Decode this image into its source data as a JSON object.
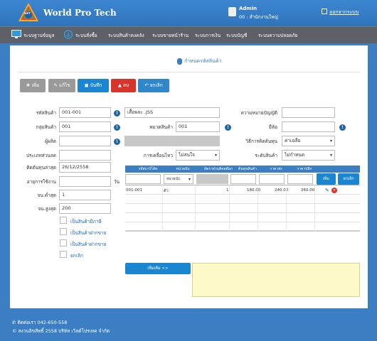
{
  "header": {
    "app_title": "World Pro Tech",
    "logo_text": "WPT",
    "user_name": "Admin",
    "user_branch": "00 : สำนักงานใหญ่",
    "logout_label": "ออกจากระบบ"
  },
  "nav": {
    "items": [
      {
        "label": "ระบบฐานข้อมูล"
      },
      {
        "label": "ระบบสั่งซื้อ"
      },
      {
        "label": "ระบบสินค้าคงคลัง"
      },
      {
        "label": "ระบบขายหน้าร้าน"
      },
      {
        "label": "ระบบการเงิน"
      },
      {
        "label": "ระบบบัญชี"
      },
      {
        "label": "ระบบความปลอดภัย"
      }
    ]
  },
  "page": {
    "title": "กำหนดรหัสสินค้า"
  },
  "toolbar": {
    "add_label": "เพิ่ม",
    "edit_label": "แก้ไข",
    "save_label": "บันทึก",
    "delete_label": "ลบ",
    "cancel_label": "ยกเลิก"
  },
  "form": {
    "product_code_label": "รหัสสินค้า",
    "product_code_value": "001-001",
    "product_name_value": "เสื้อพละ .JSS",
    "meaning_label": "ความหมายบัญญัติ",
    "group_label": "กลุ่มสินค้า",
    "group_value": "001",
    "category_label": "หมวดสินค้า",
    "category_value": "001",
    "brand_label": "ยี่ห้อ",
    "manufacturer_label": "ผู้ผลิต",
    "cost_method_label": "วิธีการคิดต้นทุน",
    "cost_method_value": "ค่าเฉลี่ย",
    "discount_label": "ประเภทส่วนลด",
    "movement_label": "การเคลื่อนไหว",
    "movement_value": "ไม่สนใจ",
    "product_level_label": "ระดับสินค้า",
    "product_level_value": "ไม่กำหนด",
    "cost_date_label": "คิดต้นทุนล่าสุด",
    "cost_date_value": "26/12/2558",
    "shelf_life_label": "อายุการใช้งาน",
    "shelf_life_unit": "วัน",
    "min_qty_label": "จน.ต่ำสุด",
    "min_qty_value": "1",
    "max_qty_label": "จน.สูงสุด",
    "max_qty_value": "200"
  },
  "checkboxes": [
    {
      "label": "เป็นสินค้ามีภาษี"
    },
    {
      "label": "เป็นสินค้าฝากขาย"
    },
    {
      "label": "เป็นสินค้าฝากขาย"
    },
    {
      "label": "ยกเลิก"
    }
  ],
  "grid": {
    "headers": [
      "รหัสบาร์โค้ด",
      "หน่วยนับ",
      "อัตราส่วนคิดสต๊อก",
      "ต้นทุนสินค้า",
      "ราคาส่ง",
      "ราคาปลีก"
    ],
    "unit_select_value": "หน่วยนับ",
    "add_button": "เพิ่ม",
    "cancel_button": "ยกเลิก",
    "rows": [
      {
        "barcode": "001-001",
        "unit": "ตัว",
        "ratio": "1",
        "cost": "180.00",
        "wholesale": "240.00",
        "retail": "260.00"
      }
    ]
  },
  "notes": {
    "button_label": "เพิ่มเติม >>"
  },
  "footer": {
    "phone": "ติดต่อเรา 042-650-558",
    "copyright": "© สงวนลิขสิทธิ์ 2558 บริษัท เวิลด์โปรเทค จำกัด"
  },
  "colors": {
    "primary": "#3b7ec4",
    "nav_bg": "#5d6066",
    "add_button": "#9a9a9a",
    "save_button": "#1a85d0",
    "delete_button": "#d9342b",
    "cancel_button": "#2f86c8",
    "note_bg": "#fdf9c9"
  }
}
